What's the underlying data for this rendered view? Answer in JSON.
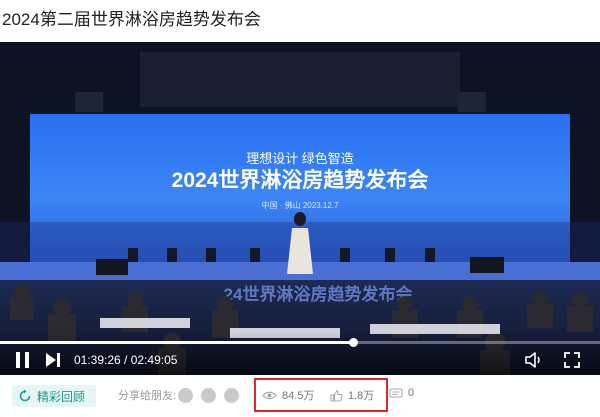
{
  "page": {
    "title": "2024第二届世界淋浴房趋势发布会"
  },
  "video": {
    "stage_tagline": "理想设计  绿色智造",
    "stage_title": "2024世界淋浴房趋势发布会",
    "stage_place_date": "中国 · 佛山   2023.12.7",
    "floor_banner": "24世界淋浴房趋势发布会"
  },
  "player": {
    "current_time": "01:39:26",
    "time_separator": " / ",
    "total_time": "02:49:05",
    "progress_fraction": 0.588,
    "accent": "#ffffff"
  },
  "actions": {
    "replay_label": "精彩回顾",
    "share_label": "分享给朋友:",
    "share_icons": [
      "wechat-icon",
      "weibo-icon",
      "qq-icon"
    ],
    "views": "84.5万",
    "likes": "1.8万",
    "comments": "0",
    "highlight_color": "#e0262c",
    "replay_color": "#1a9a8a"
  }
}
